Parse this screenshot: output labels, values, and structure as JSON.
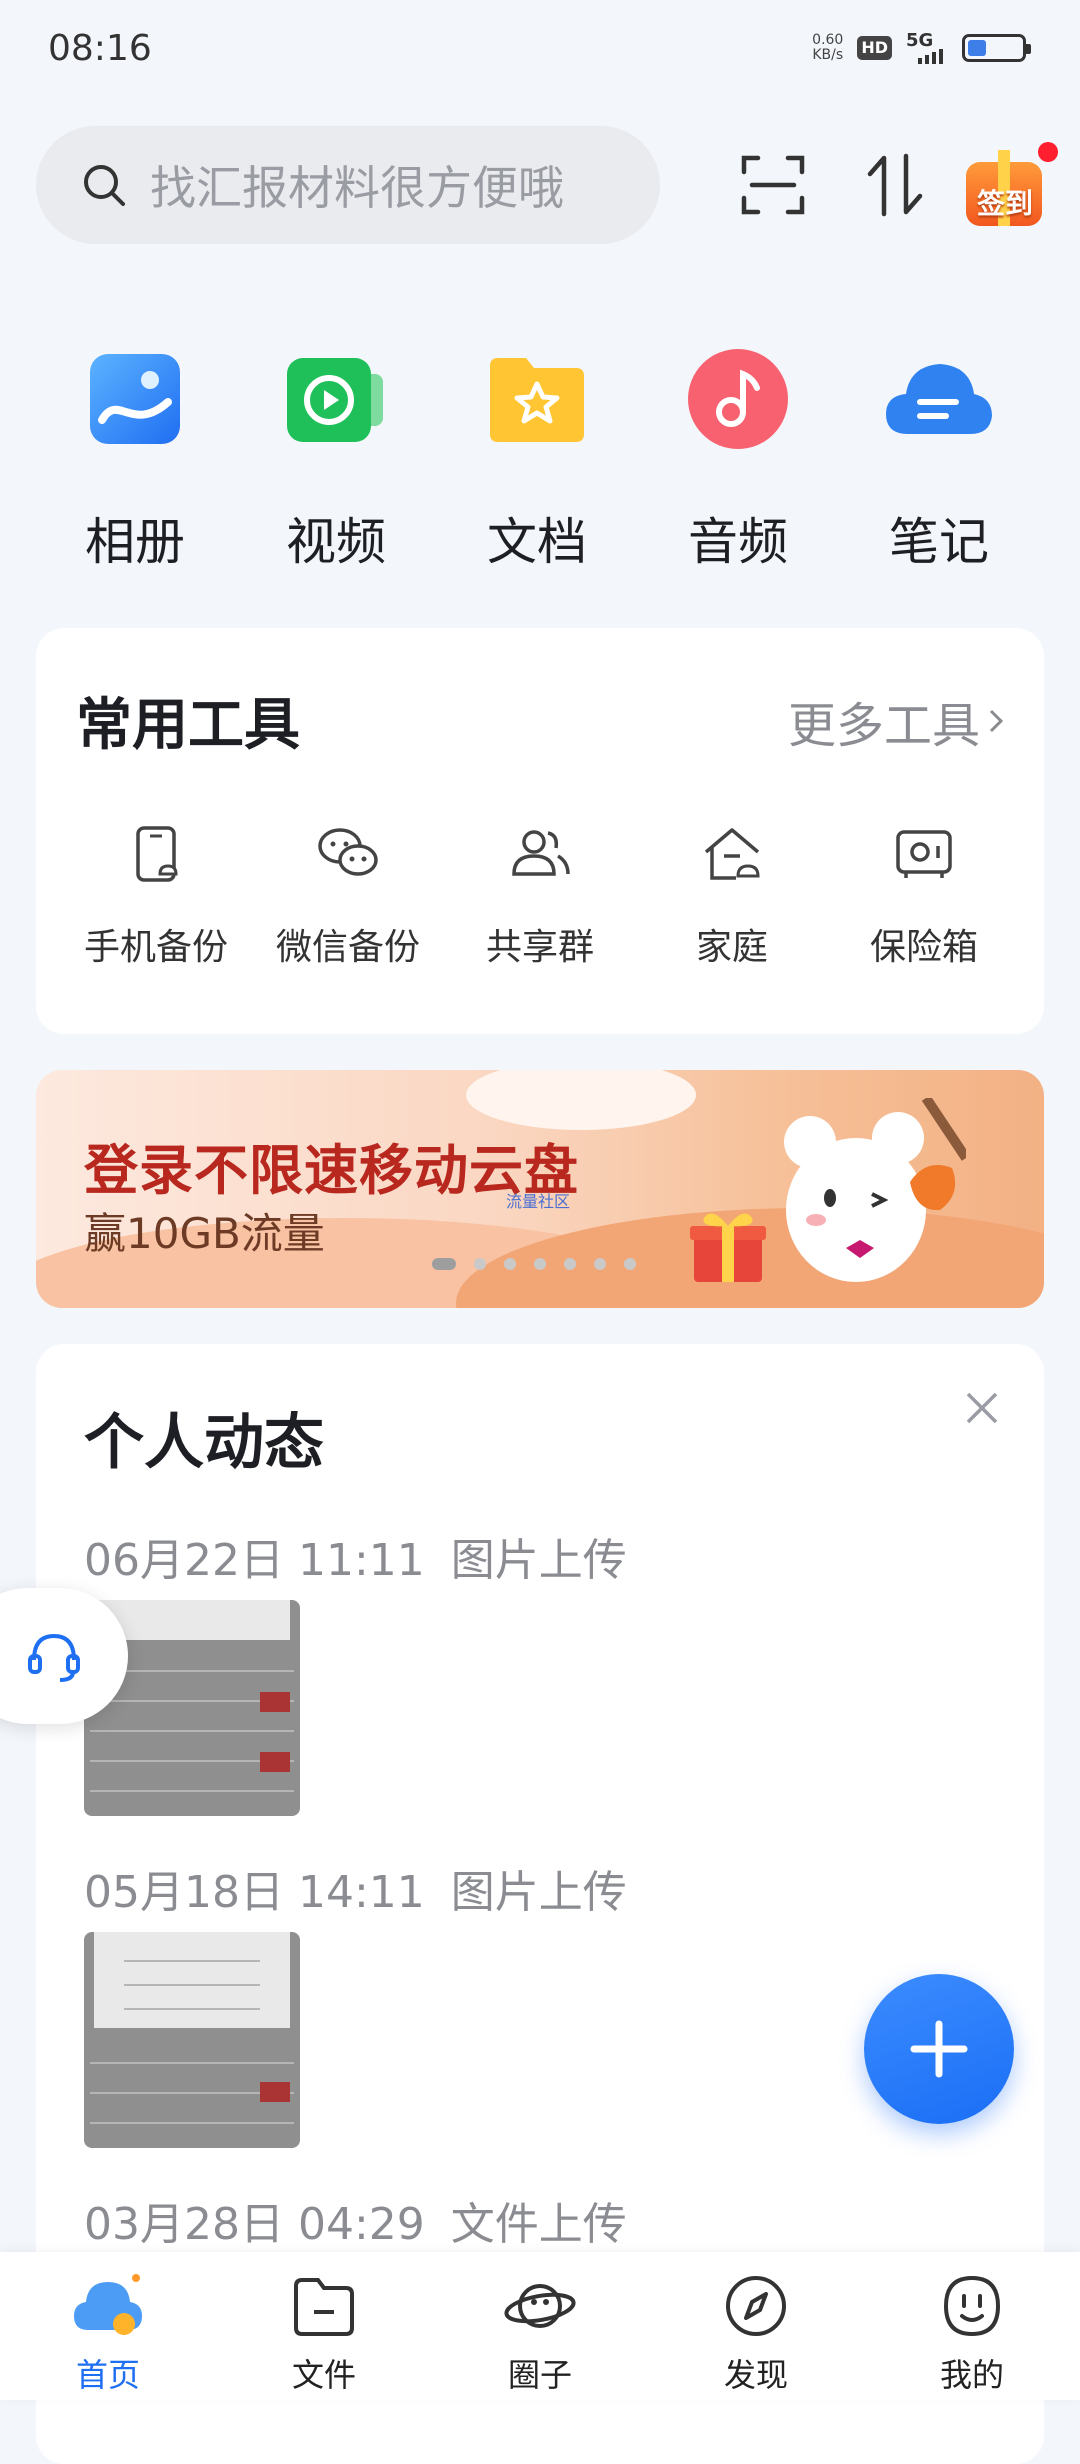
{
  "status_bar": {
    "time": "08:16",
    "net_speed_value": "0.60",
    "net_speed_unit": "KB/s",
    "hd_label": "HD",
    "network_type": "5G",
    "battery_level": 0.35
  },
  "search": {
    "placeholder": "找汇报材料很方便哦"
  },
  "header_actions": {
    "scan_icon": "scan-icon",
    "transfer_icon": "transfer-icon",
    "signin_label": "签到"
  },
  "quick_nav": [
    {
      "label": "相册",
      "icon": "album-icon",
      "color": "#2f7df2"
    },
    {
      "label": "视频",
      "icon": "video-icon",
      "color": "#22c45f"
    },
    {
      "label": "文档",
      "icon": "document-icon",
      "color": "#ffc233"
    },
    {
      "label": "音频",
      "icon": "audio-icon",
      "color": "#f65a6a"
    },
    {
      "label": "笔记",
      "icon": "note-icon",
      "color": "#3a8df3"
    }
  ],
  "tools": {
    "title": "常用工具",
    "more_label": "更多工具",
    "items": [
      {
        "label": "手机备份",
        "icon": "phone-backup-icon"
      },
      {
        "label": "微信备份",
        "icon": "wechat-backup-icon"
      },
      {
        "label": "共享群",
        "icon": "share-group-icon"
      },
      {
        "label": "家庭",
        "icon": "family-icon"
      },
      {
        "label": "保险箱",
        "icon": "safe-icon"
      }
    ]
  },
  "banner": {
    "headline": "登录不限速移动云盘",
    "subline": "赢10GB流量",
    "tag": "流量社区",
    "page_count": 7,
    "active_page": 1
  },
  "activity": {
    "title": "个人动态",
    "items": [
      {
        "date": "06月22日 11:11",
        "type": "图片上传"
      },
      {
        "date": "05月18日 14:11",
        "type": "图片上传"
      },
      {
        "date": "03月28日 04:29",
        "type": "文件上传"
      }
    ]
  },
  "bottom_nav": [
    {
      "label": "首页",
      "icon": "cloud-home-icon",
      "active": true
    },
    {
      "label": "文件",
      "icon": "folder-icon",
      "active": false
    },
    {
      "label": "圈子",
      "icon": "planet-icon",
      "active": false
    },
    {
      "label": "发现",
      "icon": "compass-icon",
      "active": false
    },
    {
      "label": "我的",
      "icon": "profile-face-icon",
      "active": false
    }
  ],
  "colors": {
    "accent": "#1f6ff2",
    "background": "#f3f6fb",
    "banner_red": "#b8281f"
  }
}
